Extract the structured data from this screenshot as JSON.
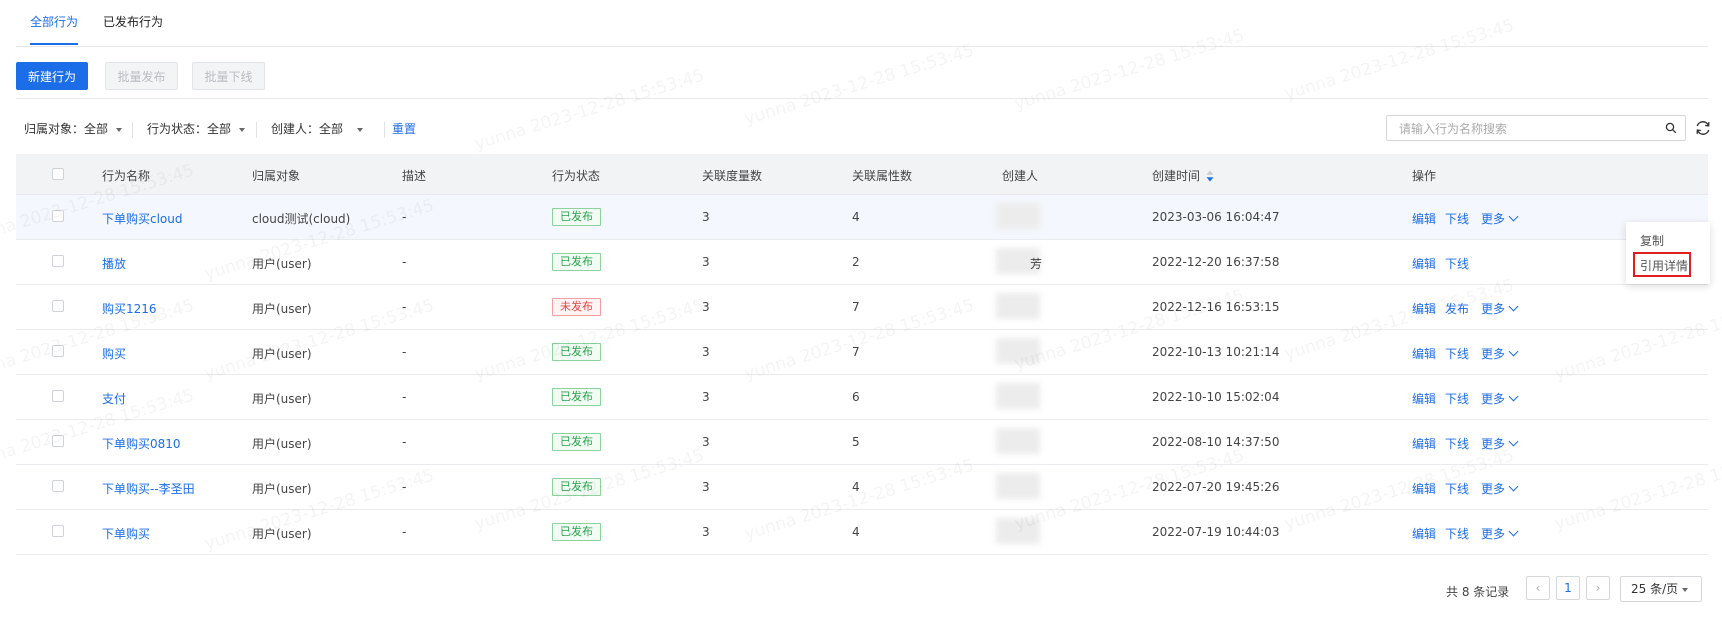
{
  "tabs": [
    {
      "label": "全部行为",
      "active": true
    },
    {
      "label": "已发布行为",
      "active": false
    }
  ],
  "toolbar": {
    "create_label": "新建行为",
    "batch_publish_label": "批量发布",
    "batch_offline_label": "批量下线"
  },
  "filters": {
    "owner": "归属对象：全部",
    "status": "行为状态：全部",
    "creator": "创建人：全部",
    "reset": "重置"
  },
  "search": {
    "placeholder": "请输入行为名称搜索"
  },
  "table": {
    "headers": {
      "name": "行为名称",
      "owner": "归属对象",
      "desc": "描述",
      "status": "行为状态",
      "metrics": "关联度量数",
      "attrs": "关联属性数",
      "creator": "创建人",
      "created": "创建时间",
      "ops": "操作"
    },
    "rows": [
      {
        "name": "下单购买cloud",
        "owner": "cloud测试(cloud)",
        "desc": "-",
        "status": "已发布",
        "published": true,
        "metrics": "3",
        "attrs": "4",
        "creator": "",
        "created": "2023-03-06 16:04:47",
        "op1": "编辑",
        "op2": "下线",
        "more": "更多"
      },
      {
        "name": "播放",
        "owner": "用户(user)",
        "desc": "-",
        "status": "已发布",
        "published": true,
        "metrics": "3",
        "attrs": "2",
        "creator": "芳",
        "created": "2022-12-20 16:37:58",
        "op1": "编辑",
        "op2": "下线",
        "more": ""
      },
      {
        "name": "购买1216",
        "owner": "用户(user)",
        "desc": "-",
        "status": "未发布",
        "published": false,
        "metrics": "3",
        "attrs": "7",
        "creator": "",
        "created": "2022-12-16 16:53:15",
        "op1": "编辑",
        "op2": "发布",
        "more": "更多"
      },
      {
        "name": "购买",
        "owner": "用户(user)",
        "desc": "-",
        "status": "已发布",
        "published": true,
        "metrics": "3",
        "attrs": "7",
        "creator": "",
        "created": "2022-10-13 10:21:14",
        "op1": "编辑",
        "op2": "下线",
        "more": "更多"
      },
      {
        "name": "支付",
        "owner": "用户(user)",
        "desc": "-",
        "status": "已发布",
        "published": true,
        "metrics": "3",
        "attrs": "6",
        "creator": "",
        "created": "2022-10-10 15:02:04",
        "op1": "编辑",
        "op2": "下线",
        "more": "更多"
      },
      {
        "name": "下单购买0810",
        "owner": "用户(user)",
        "desc": "-",
        "status": "已发布",
        "published": true,
        "metrics": "3",
        "attrs": "5",
        "creator": "",
        "created": "2022-08-10 14:37:50",
        "op1": "编辑",
        "op2": "下线",
        "more": "更多"
      },
      {
        "name": "下单购买--李圣田",
        "owner": "用户(user)",
        "desc": "-",
        "status": "已发布",
        "published": true,
        "metrics": "3",
        "attrs": "4",
        "creator": "",
        "created": "2022-07-20 19:45:26",
        "op1": "编辑",
        "op2": "下线",
        "more": "更多"
      },
      {
        "name": "下单购买",
        "owner": "用户(user)",
        "desc": "-",
        "status": "已发布",
        "published": true,
        "metrics": "3",
        "attrs": "4",
        "creator": "",
        "created": "2022-07-19 10:44:03",
        "op1": "编辑",
        "op2": "下线",
        "more": "更多"
      }
    ]
  },
  "dropdown": {
    "copy": "复制",
    "ref_detail": "引用详情"
  },
  "pagination": {
    "total": "共 8 条记录",
    "current_page": "1",
    "page_size": "25 条/页"
  },
  "watermark": "yunna 2023-12-28 15:53:45",
  "colors": {
    "accent": "#1c6ee8",
    "published": "#2aa24b",
    "unpublished": "#e54545",
    "highlight_box": "#e02020"
  }
}
